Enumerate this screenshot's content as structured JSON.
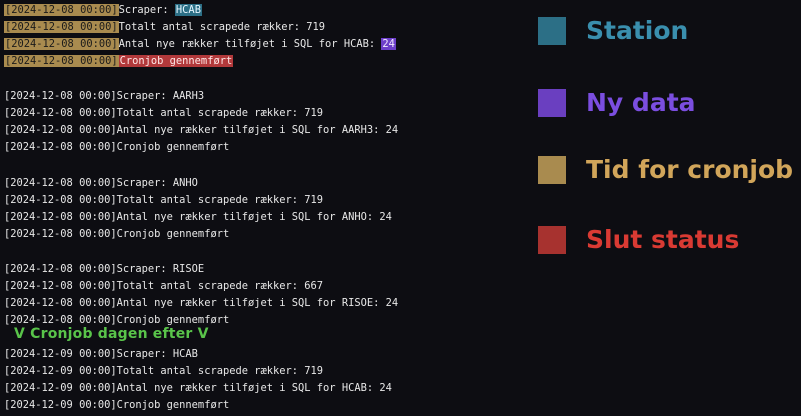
{
  "terminal": {
    "groups": [
      {
        "lines": [
          {
            "ts": "[2024-12-08 00:00]",
            "text": "Scraper: ",
            "value": "HCAB"
          },
          {
            "ts": "[2024-12-08 00:00]",
            "text": "Totalt antal scrapede rækker: 719"
          },
          {
            "ts": "[2024-12-08 00:00]",
            "text": "Antal nye rækker tilføjet i SQL for HCAB: ",
            "value": "24"
          },
          {
            "ts": "[2024-12-08 00:00]",
            "text": "",
            "value": "Cronjob gennemført"
          }
        ]
      },
      {
        "lines": [
          {
            "ts": "[2024-12-08 00:00]",
            "text": "Scraper: AARH3"
          },
          {
            "ts": "[2024-12-08 00:00]",
            "text": "Totalt antal scrapede rækker: 719"
          },
          {
            "ts": "[2024-12-08 00:00]",
            "text": "Antal nye rækker tilføjet i SQL for AARH3: 24"
          },
          {
            "ts": "[2024-12-08 00:00]",
            "text": "Cronjob gennemført"
          }
        ]
      },
      {
        "lines": [
          {
            "ts": "[2024-12-08 00:00]",
            "text": "Scraper: ANHO"
          },
          {
            "ts": "[2024-12-08 00:00]",
            "text": "Totalt antal scrapede rækker: 719"
          },
          {
            "ts": "[2024-12-08 00:00]",
            "text": "Antal nye rækker tilføjet i SQL for ANHO: 24"
          },
          {
            "ts": "[2024-12-08 00:00]",
            "text": "Cronjob gennemført"
          }
        ]
      },
      {
        "lines": [
          {
            "ts": "[2024-12-08 00:00]",
            "text": "Scraper: RISOE"
          },
          {
            "ts": "[2024-12-08 00:00]",
            "text": "Totalt antal scrapede rækker: 667"
          },
          {
            "ts": "[2024-12-08 00:00]",
            "text": "Antal nye rækker tilføjet i SQL for RISOE: 24"
          },
          {
            "ts": "[2024-12-08 00:00]",
            "text": "Cronjob gennemført"
          }
        ]
      },
      {
        "lines": [
          {
            "ts": "[2024-12-09 00:00]",
            "text": "Scraper: HCAB"
          },
          {
            "ts": "[2024-12-09 00:00]",
            "text": "Totalt antal scrapede rækker: 719"
          },
          {
            "ts": "[2024-12-09 00:00]",
            "text": "Antal nye rækker tilføjet i SQL for HCAB: 24"
          },
          {
            "ts": "[2024-12-09 00:00]",
            "text": "Cronjob gennemført"
          }
        ]
      }
    ],
    "note": "V Cronjob dagen efter V"
  },
  "legend": [
    {
      "label": "Station",
      "color": "#2c6f86",
      "text_color": "#3a8fae"
    },
    {
      "label": "Ny data",
      "color": "#6a3fc0",
      "text_color": "#7b4ee0"
    },
    {
      "label": "Tid for cronjob",
      "color": "#a98b4f",
      "text_color": "#d1a55a"
    },
    {
      "label": "Slut status",
      "color": "#a7322f",
      "text_color": "#d93a33"
    }
  ]
}
